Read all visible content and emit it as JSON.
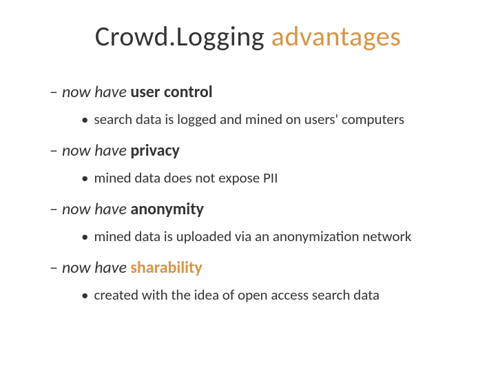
{
  "title": {
    "part1": "Crowd.",
    "part2": "Logging",
    "part3": " advantages"
  },
  "items": [
    {
      "prefix": "now have ",
      "bold": "user control",
      "orange": false,
      "sub": "search data is logged and mined on users' computers"
    },
    {
      "prefix": "now have ",
      "bold": "privacy",
      "orange": false,
      "sub": "mined data does not expose PII"
    },
    {
      "prefix": "now have ",
      "bold": "anonymity",
      "orange": false,
      "sub": "mined data is uploaded via an anonymization network"
    },
    {
      "prefix": "now have ",
      "bold": "sharability",
      "orange": true,
      "sub": "created with the idea of open access search data"
    }
  ]
}
